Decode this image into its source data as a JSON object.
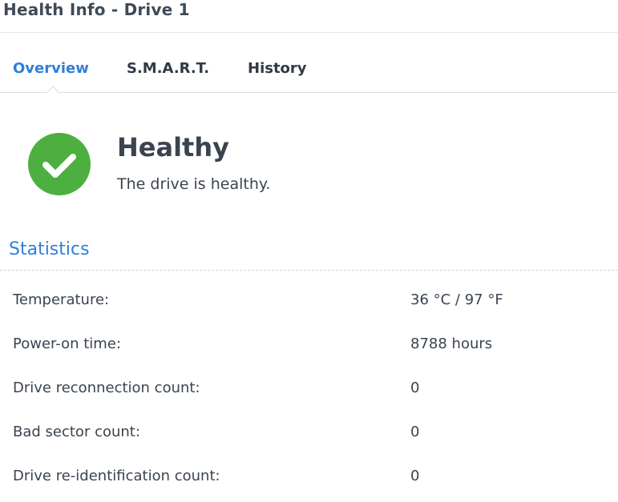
{
  "window": {
    "title": "Health Info - Drive 1"
  },
  "tabs": [
    {
      "label": "Overview",
      "active": true
    },
    {
      "label": "S.M.A.R.T.",
      "active": false
    },
    {
      "label": "History",
      "active": false
    }
  ],
  "status": {
    "icon": "check-circle-icon",
    "icon_color": "#4caf3f",
    "title": "Healthy",
    "description": "The drive is healthy."
  },
  "statistics": {
    "title": "Statistics",
    "rows": [
      {
        "label": "Temperature:",
        "value": "36 °C / 97 °F"
      },
      {
        "label": "Power-on time:",
        "value": "8788 hours"
      },
      {
        "label": "Drive reconnection count:",
        "value": "0"
      },
      {
        "label": "Bad sector count:",
        "value": "0"
      },
      {
        "label": "Drive re-identification count:",
        "value": "0"
      }
    ]
  },
  "colors": {
    "accent": "#2f7fd8",
    "text": "#3a4450",
    "healthy": "#4caf3f"
  }
}
